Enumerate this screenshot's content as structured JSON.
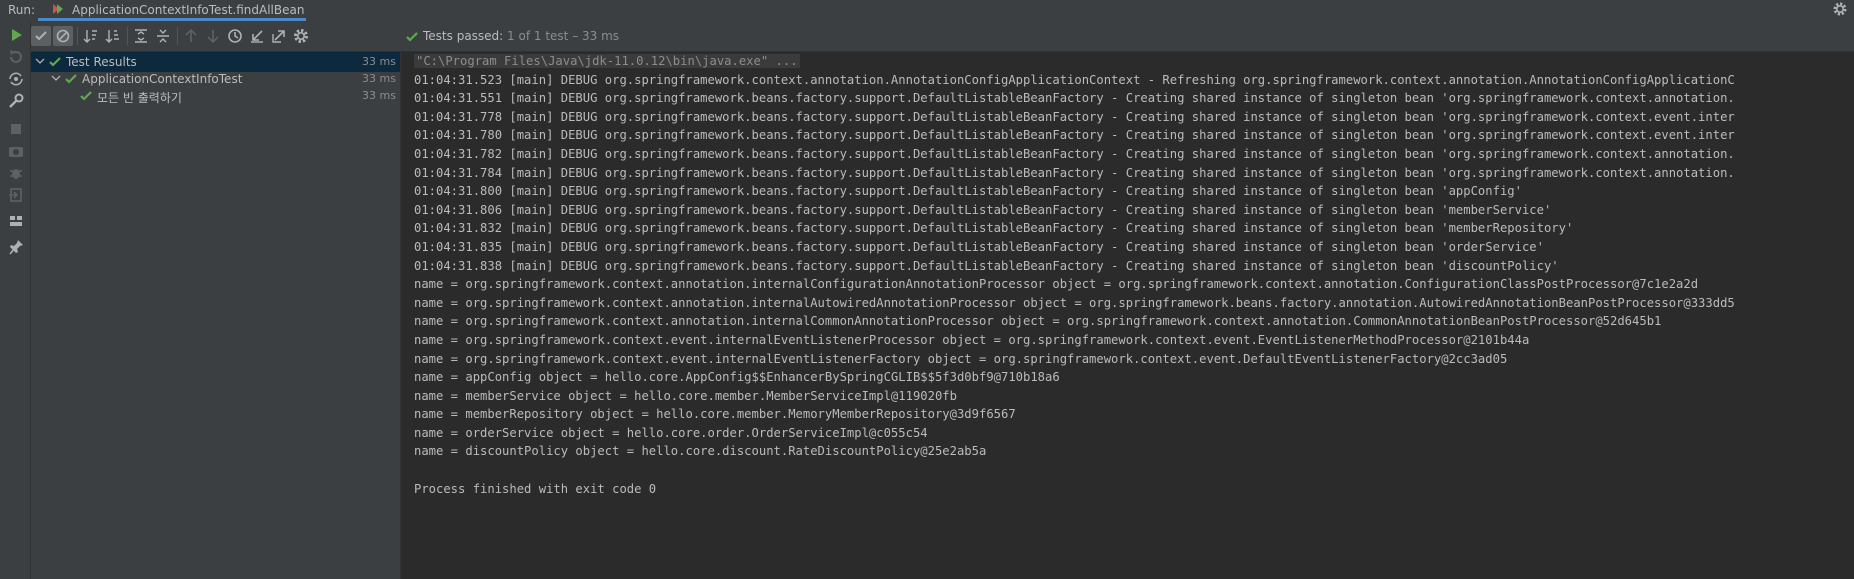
{
  "run_bar": {
    "label": "Run:",
    "tab_title": "ApplicationContextInfoTest.findAllBean"
  },
  "status": {
    "prefix": "Tests passed:",
    "count": "1",
    "suffix": "of 1 test – 33 ms"
  },
  "tree": [
    {
      "label": "Test Results",
      "duration": "33 ms"
    },
    {
      "label": "ApplicationContextInfoTest",
      "duration": "33 ms"
    },
    {
      "label": "모든 빈 출력하기",
      "duration": "33 ms"
    }
  ],
  "console": {
    "command": "\"C:\\Program Files\\Java\\jdk-11.0.12\\bin\\java.exe\" ...",
    "lines": [
      "01:04:31.523 [main] DEBUG org.springframework.context.annotation.AnnotationConfigApplicationContext - Refreshing org.springframework.context.annotation.AnnotationConfigApplicationC",
      "01:04:31.551 [main] DEBUG org.springframework.beans.factory.support.DefaultListableBeanFactory - Creating shared instance of singleton bean 'org.springframework.context.annotation.",
      "01:04:31.778 [main] DEBUG org.springframework.beans.factory.support.DefaultListableBeanFactory - Creating shared instance of singleton bean 'org.springframework.context.event.inter",
      "01:04:31.780 [main] DEBUG org.springframework.beans.factory.support.DefaultListableBeanFactory - Creating shared instance of singleton bean 'org.springframework.context.event.inter",
      "01:04:31.782 [main] DEBUG org.springframework.beans.factory.support.DefaultListableBeanFactory - Creating shared instance of singleton bean 'org.springframework.context.annotation.",
      "01:04:31.784 [main] DEBUG org.springframework.beans.factory.support.DefaultListableBeanFactory - Creating shared instance of singleton bean 'org.springframework.context.annotation.",
      "01:04:31.800 [main] DEBUG org.springframework.beans.factory.support.DefaultListableBeanFactory - Creating shared instance of singleton bean 'appConfig'",
      "01:04:31.806 [main] DEBUG org.springframework.beans.factory.support.DefaultListableBeanFactory - Creating shared instance of singleton bean 'memberService'",
      "01:04:31.832 [main] DEBUG org.springframework.beans.factory.support.DefaultListableBeanFactory - Creating shared instance of singleton bean 'memberRepository'",
      "01:04:31.835 [main] DEBUG org.springframework.beans.factory.support.DefaultListableBeanFactory - Creating shared instance of singleton bean 'orderService'",
      "01:04:31.838 [main] DEBUG org.springframework.beans.factory.support.DefaultListableBeanFactory - Creating shared instance of singleton bean 'discountPolicy'",
      "name = org.springframework.context.annotation.internalConfigurationAnnotationProcessor object = org.springframework.context.annotation.ConfigurationClassPostProcessor@7c1e2a2d",
      "name = org.springframework.context.annotation.internalAutowiredAnnotationProcessor object = org.springframework.beans.factory.annotation.AutowiredAnnotationBeanPostProcessor@333dd5",
      "name = org.springframework.context.annotation.internalCommonAnnotationProcessor object = org.springframework.context.annotation.CommonAnnotationBeanPostProcessor@52d645b1",
      "name = org.springframework.context.event.internalEventListenerProcessor object = org.springframework.context.event.EventListenerMethodProcessor@2101b44a",
      "name = org.springframework.context.event.internalEventListenerFactory object = org.springframework.context.event.DefaultEventListenerFactory@2cc3ad05",
      "name = appConfig object = hello.core.AppConfig$$EnhancerBySpringCGLIB$$5f3d0bf9@710b18a6",
      "name = memberService object = hello.core.member.MemberServiceImpl@119020fb",
      "name = memberRepository object = hello.core.member.MemoryMemberRepository@3d9f6567",
      "name = orderService object = hello.core.order.OrderServiceImpl@c055c54",
      "name = discountPolicy object = hello.core.discount.RateDiscountPolicy@25e2ab5a",
      "",
      "Process finished with exit code 0"
    ]
  },
  "colors": {
    "accent_green": "#5fa84e",
    "selection": "#0d293e",
    "tab_underline": "#4a88c7"
  }
}
